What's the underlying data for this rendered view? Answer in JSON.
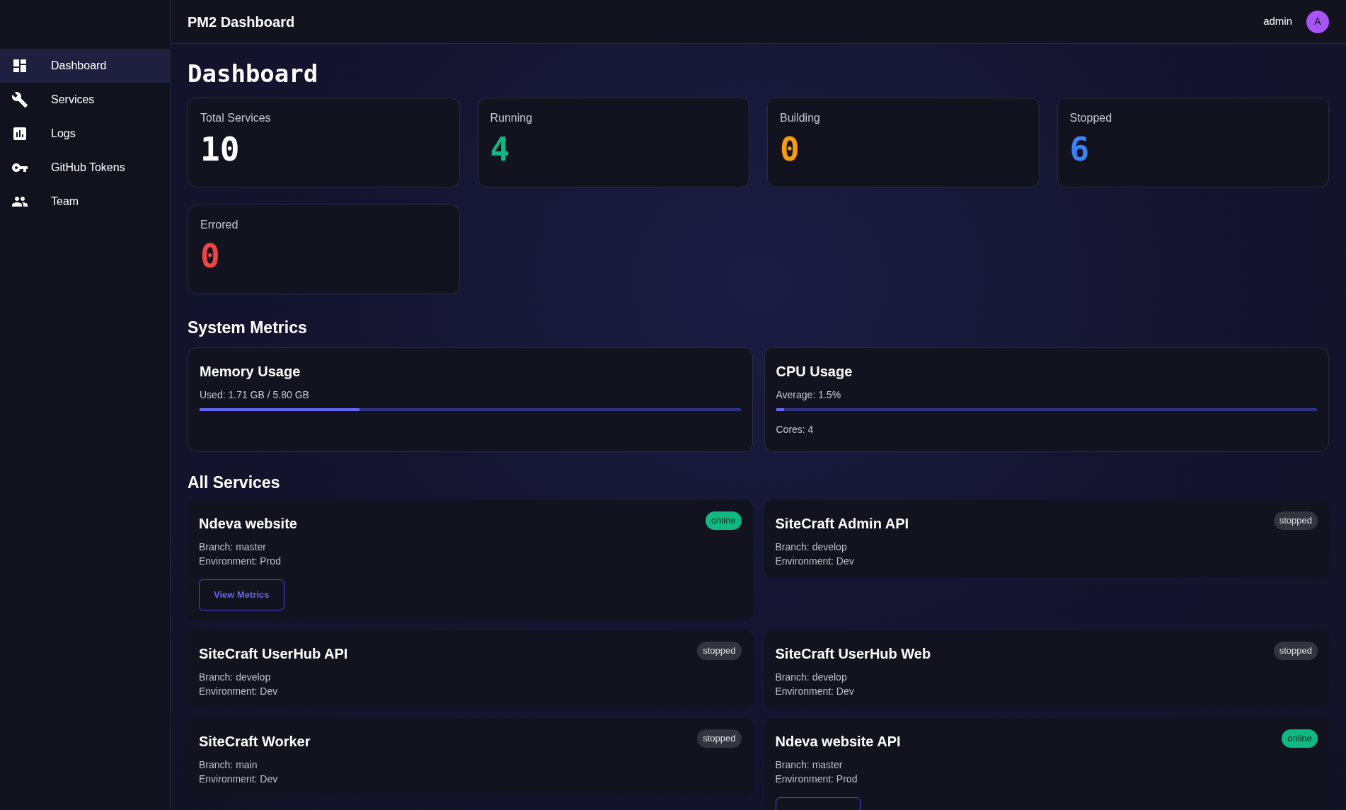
{
  "sidebar": {
    "items": [
      {
        "label": "Dashboard",
        "selected": true
      },
      {
        "label": "Services",
        "selected": false
      },
      {
        "label": "Logs",
        "selected": false
      },
      {
        "label": "GitHub Tokens",
        "selected": false
      },
      {
        "label": "Team",
        "selected": false
      }
    ]
  },
  "header": {
    "title": "PM2 Dashboard",
    "user": "admin",
    "avatar": "A"
  },
  "page_title": "Dashboard",
  "stats": [
    {
      "label": "Total Services",
      "value": "10",
      "color": "#ffffff"
    },
    {
      "label": "Running",
      "value": "4",
      "color": "#10b981"
    },
    {
      "label": "Building",
      "value": "0",
      "color": "#f59e0b"
    },
    {
      "label": "Stopped",
      "value": "6",
      "color": "#3b82f6"
    },
    {
      "label": "Errored",
      "value": "0",
      "color": "#ef4444"
    }
  ],
  "metrics_heading": "System Metrics",
  "metrics": [
    {
      "title": "Memory Usage",
      "reading": "Used: 1.71 GB / 5.80 GB",
      "level": 0.295
    },
    {
      "title": "CPU Usage",
      "reading": "Average: 1.5%",
      "level": 0.015,
      "note": "Cores: 4"
    }
  ],
  "services_heading": "All Services",
  "services": [
    {
      "name": "Ndeva website",
      "status": "online",
      "branch": "Branch: master",
      "environment": "Environment: Prod",
      "metrics_button": true,
      "button_label": "View Metrics"
    },
    {
      "name": "SiteCraft Admin API",
      "status": "stopped",
      "branch": "Branch: develop",
      "environment": "Environment: Dev",
      "metrics_button": false
    },
    {
      "name": "SiteCraft UserHub API",
      "status": "stopped",
      "branch": "Branch: develop",
      "environment": "Environment: Dev",
      "metrics_button": false
    },
    {
      "name": "SiteCraft UserHub Web",
      "status": "stopped",
      "branch": "Branch: develop",
      "environment": "Environment: Dev",
      "metrics_button": false
    },
    {
      "name": "SiteCraft Worker",
      "status": "stopped",
      "branch": "Branch: main",
      "environment": "Environment: Dev",
      "metrics_button": false
    },
    {
      "name": "Ndeva website API",
      "status": "online",
      "branch": "Branch: master",
      "environment": "Environment: Prod",
      "metrics_button": true
    }
  ]
}
